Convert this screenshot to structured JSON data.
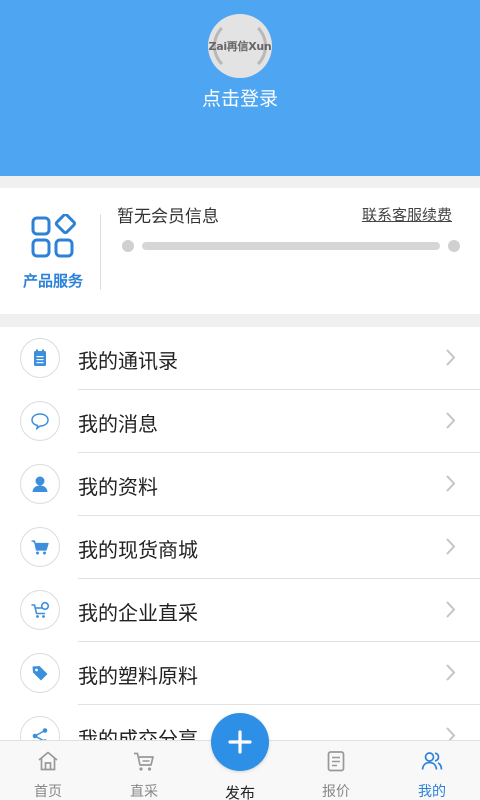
{
  "header": {
    "logo_text": "Zai再信Xun",
    "login_label": "点击登录"
  },
  "membership": {
    "service_label": "产品服务",
    "title": "暂无会员信息",
    "contact_link": "联系客服续费"
  },
  "menu": {
    "items": [
      {
        "label": "我的通讯录",
        "icon": "contacts-icon"
      },
      {
        "label": "我的消息",
        "icon": "message-icon"
      },
      {
        "label": "我的资料",
        "icon": "profile-icon"
      },
      {
        "label": "我的现货商城",
        "icon": "cart-icon"
      },
      {
        "label": "我的企业直采",
        "icon": "enterprise-cart-icon"
      },
      {
        "label": "我的塑料原料",
        "icon": "tag-icon"
      },
      {
        "label": "我的成交分享",
        "icon": "share-icon"
      }
    ]
  },
  "tabbar": {
    "home": "首页",
    "direct": "直采",
    "publish": "发布",
    "quote": "报价",
    "mine": "我的"
  },
  "colors": {
    "header_bg": "#4ea6f3",
    "accent": "#2d82d8",
    "publish_button": "#2d8fe5"
  }
}
